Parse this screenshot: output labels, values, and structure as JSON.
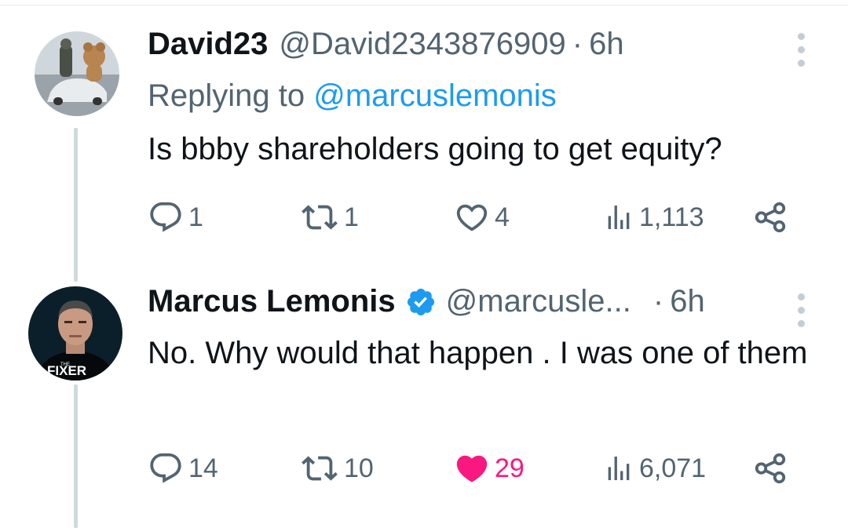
{
  "colors": {
    "accent": "#1d9bf0",
    "like_active": "#f91880",
    "secondary_text": "#536471",
    "thread_line": "#cfd9de"
  },
  "tweets": [
    {
      "name": "David23",
      "handle": "@David2343876909",
      "separator": "·",
      "time": "6h",
      "replying_prefix": "Replying to ",
      "replying_to": "@marcuslemonis",
      "text": "Is bbby shareholders going to get equity?",
      "verified": false,
      "stats": {
        "replies": "1",
        "retweets": "1",
        "likes": "4",
        "views": "1,113"
      },
      "liked": false
    },
    {
      "name": "Marcus Lemonis",
      "handle": "@marcusle...",
      "separator": "·",
      "time": "6h",
      "text": "No. Why would that happen . I was one of them",
      "verified": true,
      "avatar_label": "FIXER",
      "stats": {
        "replies": "14",
        "retweets": "10",
        "likes": "29",
        "views": "6,071"
      },
      "liked": true
    }
  ],
  "icons": [
    "reply-icon",
    "retweet-icon",
    "like-icon",
    "views-icon",
    "share-icon",
    "more-icon",
    "verified-badge-icon"
  ]
}
